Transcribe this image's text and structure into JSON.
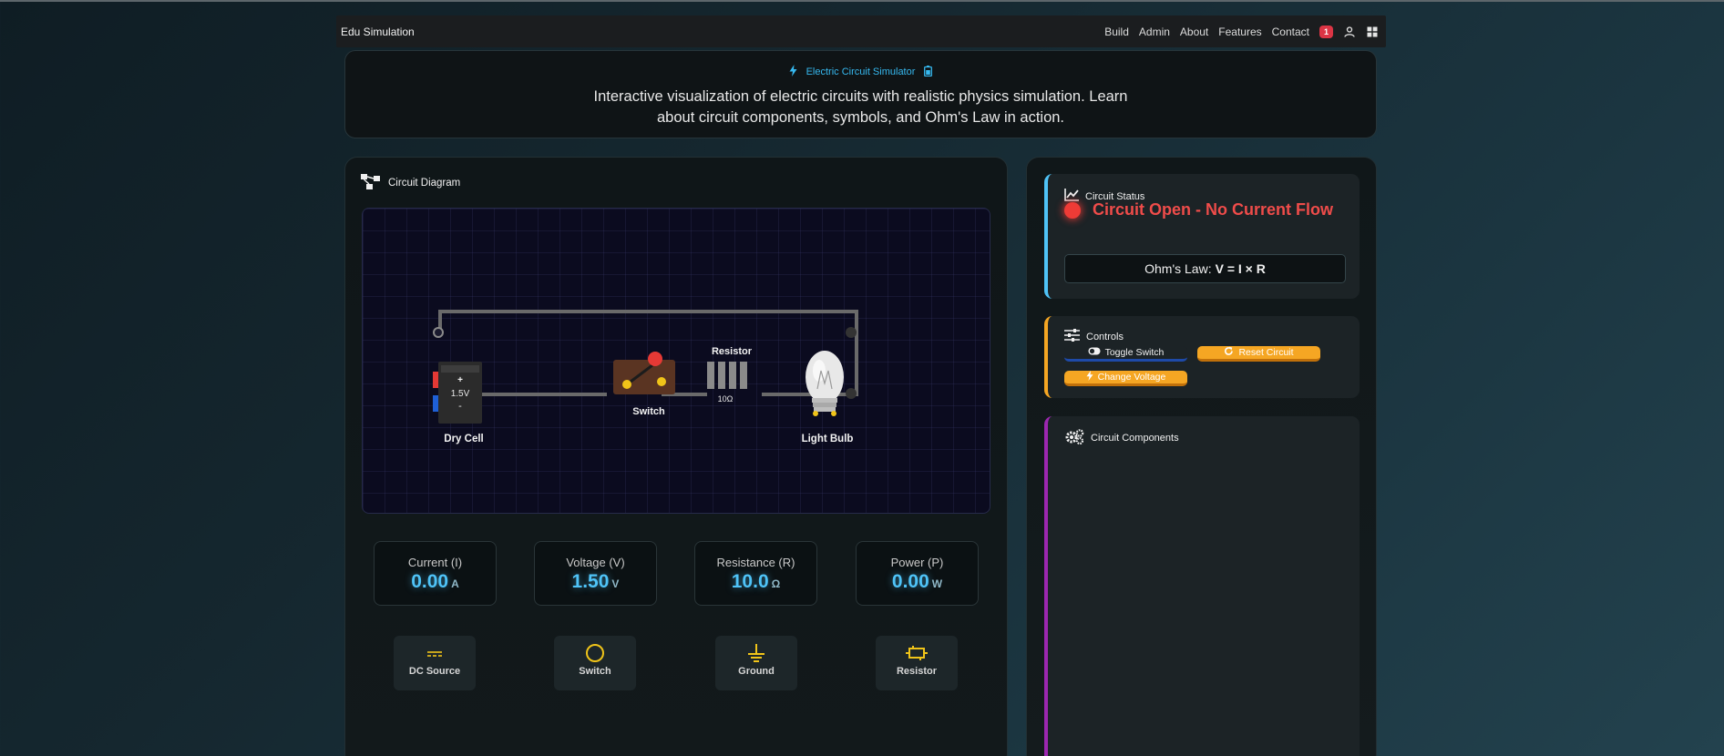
{
  "nav": {
    "brand": "Edu Simulation",
    "links": [
      "Build",
      "Admin",
      "About",
      "Features",
      "Contact"
    ],
    "badge": "1",
    "icons": [
      "user-icon",
      "grid-icon"
    ]
  },
  "header": {
    "subtitle": "Electric Circuit Simulator",
    "description": "Interactive visualization of electric circuits with realistic physics simulation. Learn about circuit components, symbols, and Ohm's Law in action."
  },
  "diagram": {
    "title": "Circuit Diagram",
    "cell": {
      "plus": "+",
      "voltage": "1.5V",
      "minus": "-",
      "label": "Dry Cell"
    },
    "switch_label": "Switch",
    "resistor": {
      "title": "Resistor",
      "value": "10Ω"
    },
    "bulb_label": "Light Bulb"
  },
  "metrics": [
    {
      "label": "Current (I)",
      "value": "0.00",
      "unit": "A"
    },
    {
      "label": "Voltage (V)",
      "value": "1.50",
      "unit": "V"
    },
    {
      "label": "Resistance (R)",
      "value": "10.0",
      "unit": "Ω"
    },
    {
      "label": "Power (P)",
      "value": "0.00",
      "unit": "W"
    }
  ],
  "symbols": [
    {
      "label": "DC Source",
      "icon": "dc-source-icon"
    },
    {
      "label": "Switch",
      "icon": "switch-symbol-icon"
    },
    {
      "label": "Ground",
      "icon": "ground-icon"
    },
    {
      "label": "Resistor",
      "icon": "resistor-icon"
    }
  ],
  "status": {
    "title": "Circuit Status",
    "message": "Circuit Open - No Current Flow",
    "ohms_prefix": "Ohm's Law:",
    "ohms_formula": "V = I × R"
  },
  "controls": {
    "title": "Controls",
    "toggle_label": "Toggle Switch",
    "reset_label": "Reset Circuit",
    "voltage_label": "Change Voltage"
  },
  "components": {
    "title": "Circuit Components"
  },
  "colors": {
    "accent_blue": "#4fc3f7",
    "status_red": "#ef4c4a",
    "button_orange": "#f5a623",
    "status_border": "#4fc3f7",
    "controls_border": "#f5a623",
    "components_border": "#9c27b0"
  }
}
